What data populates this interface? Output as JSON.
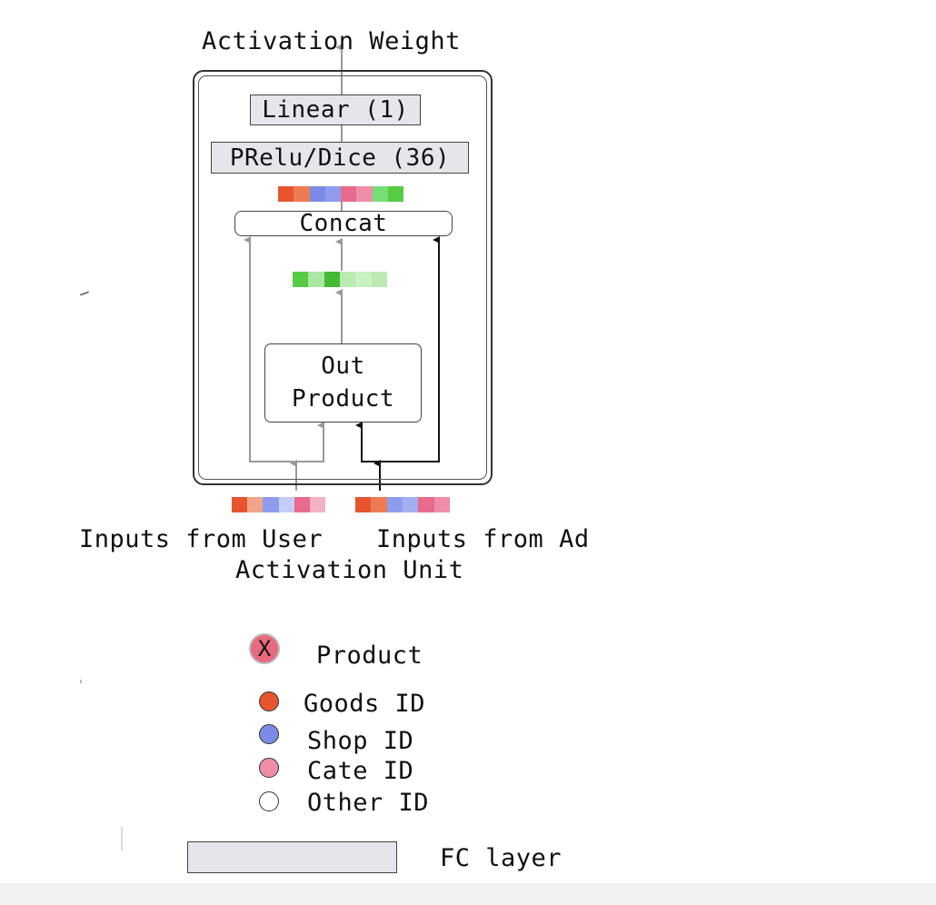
{
  "diagram": {
    "output_label": "Activation Weight",
    "linear_label": "Linear (1)",
    "prelu_label": "PRelu/Dice (36)",
    "concat_label": "Concat",
    "out_product_line1": "Out",
    "out_product_line2": "Product",
    "user_input_label": "Inputs from User",
    "ad_input_label": "Inputs from Ad",
    "unit_caption": "Activation Unit"
  },
  "strips": {
    "concat_output": [
      "#e8552d",
      "#ee7a54",
      "#7b8ae6",
      "#8f9cee",
      "#e86a8c",
      "#ee8ea8",
      "#77dd77",
      "#55cc44"
    ],
    "product_output": [
      "#55cc44",
      "#a8e8a0",
      "#44bb33",
      "#b8ecb0",
      "#c8f0c0",
      "#bde9b5"
    ],
    "user_inputs": [
      "#e8552d",
      "#f2a48a",
      "#8f9cee",
      "#c5cdf6",
      "#e86a8c",
      "#f2b3c4"
    ],
    "ad_inputs": [
      "#e8552d",
      "#ee7a54",
      "#8f9cee",
      "#a3afef",
      "#e86a8c",
      "#ee8ea8"
    ]
  },
  "legend": {
    "product_symbol": "X",
    "product_label": "Product",
    "goods_label": "Goods ID",
    "shop_label": "Shop ID",
    "cate_label": "Cate ID",
    "other_label": "Other ID",
    "fc_label": "FC layer",
    "colors": {
      "product": "#e86a7e",
      "goods": "#e8552d",
      "shop": "#7b8ae6",
      "cate": "#ee8ea8",
      "other": "#ffffff"
    }
  }
}
